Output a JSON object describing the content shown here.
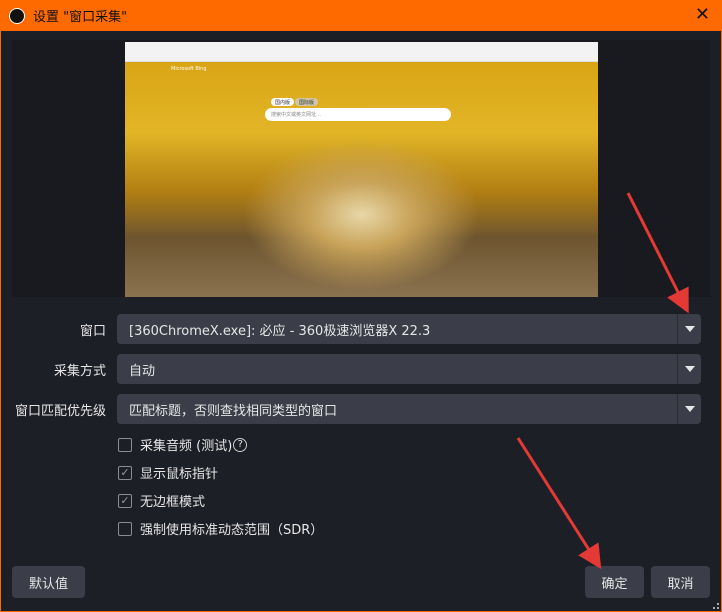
{
  "window": {
    "title": "设置 \"窗口采集\"",
    "close": "✕"
  },
  "preview": {
    "searchbox_placeholder": "搜索中文或英文网址…",
    "tab_left": "国内版",
    "tab_right": "国际版",
    "brand": "Microsoft Bing"
  },
  "fields": [
    {
      "label": "窗口",
      "value": "[360ChromeX.exe]: 必应 - 360极速浏览器X 22.3"
    },
    {
      "label": "采集方式",
      "value": "自动"
    },
    {
      "label": "窗口匹配优先级",
      "value": "匹配标题，否则查找相同类型的窗口"
    }
  ],
  "checkboxes": [
    {
      "label": "采集音频 (测试)",
      "checked": false,
      "mark": ""
    },
    {
      "label": "显示鼠标指针",
      "checked": true,
      "mark": "✓"
    },
    {
      "label": "无边框模式",
      "checked": true,
      "mark": "✓"
    },
    {
      "label": "强制使用标准动态范围（SDR）",
      "checked": false,
      "mark": ""
    }
  ],
  "help_icon": "?",
  "buttons": {
    "defaults": "默认值",
    "ok": "确定",
    "cancel": "取消"
  },
  "colors": {
    "accent": "#ff6a00",
    "annotation": "#e53935"
  }
}
